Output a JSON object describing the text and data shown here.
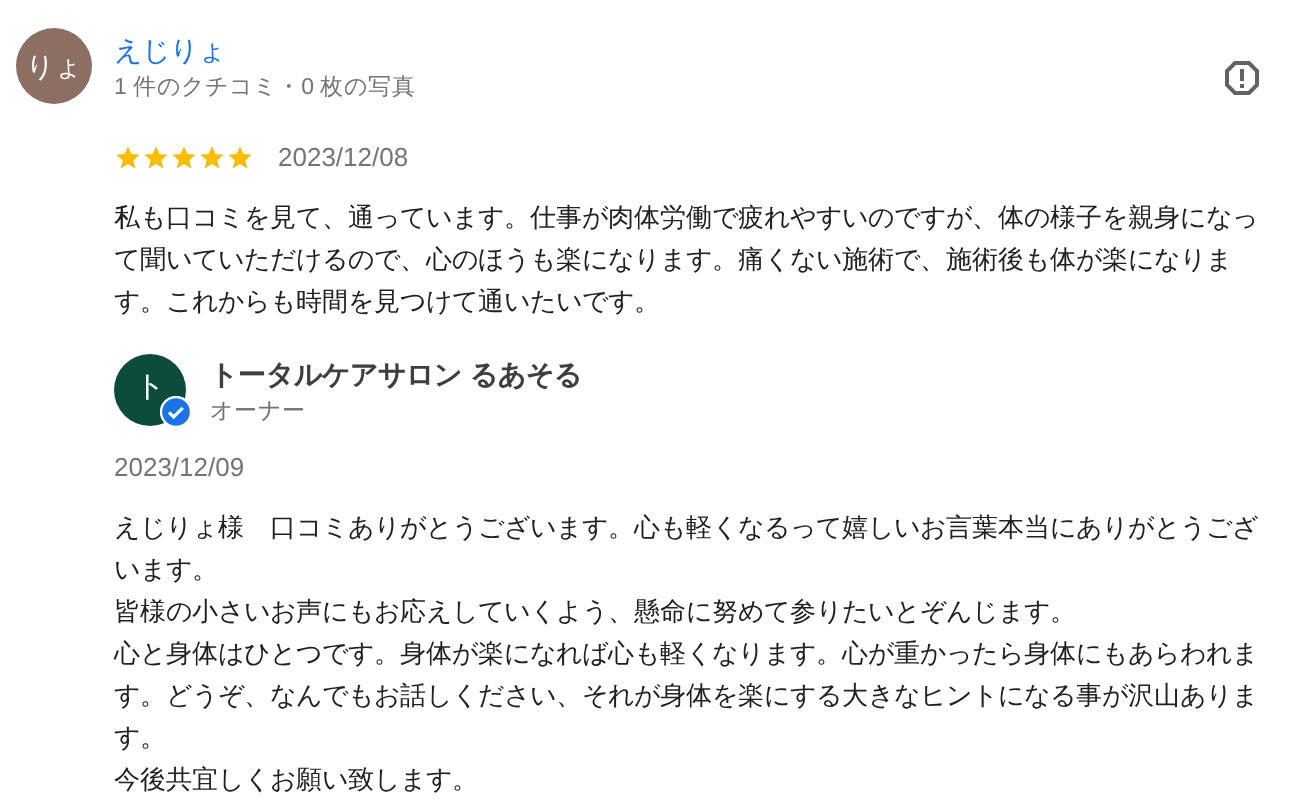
{
  "review": {
    "avatar_initials": "りょ",
    "author": "えじりょ",
    "author_meta": "1 件のクチコミ・0 枚の写真",
    "stars": 5,
    "date": "2023/12/08",
    "text": "私も口コミを見て、通っています。仕事が肉体労働で疲れやすいのですが、体の様子を親身になって聞いていただけるので、心のほうも楽になります。痛くない施術で、施術後も体が楽になります。これからも時間を見つけて通いたいです。"
  },
  "owner_reply": {
    "avatar_initial": "ト",
    "verified": true,
    "name": "トータルケアサロン るあそる",
    "role": "オーナー",
    "date": "2023/12/09",
    "paragraphs": [
      "えじりょ様　口コミありがとうございます。心も軽くなるって嬉しいお言葉本当にありがとうございます。",
      "皆様の小さいお声にもお応えしていくよう、懸命に努めて参りたいとぞんじます。",
      "心と身体はひとつです。身体が楽になれば心も軽くなります。心が重かったら身体にもあらわれます。どうぞ、なんでもお話しください、それが身体を楽にする大きなヒントになる事が沢山あります。",
      "今後共宜しくお願い致します。"
    ]
  }
}
